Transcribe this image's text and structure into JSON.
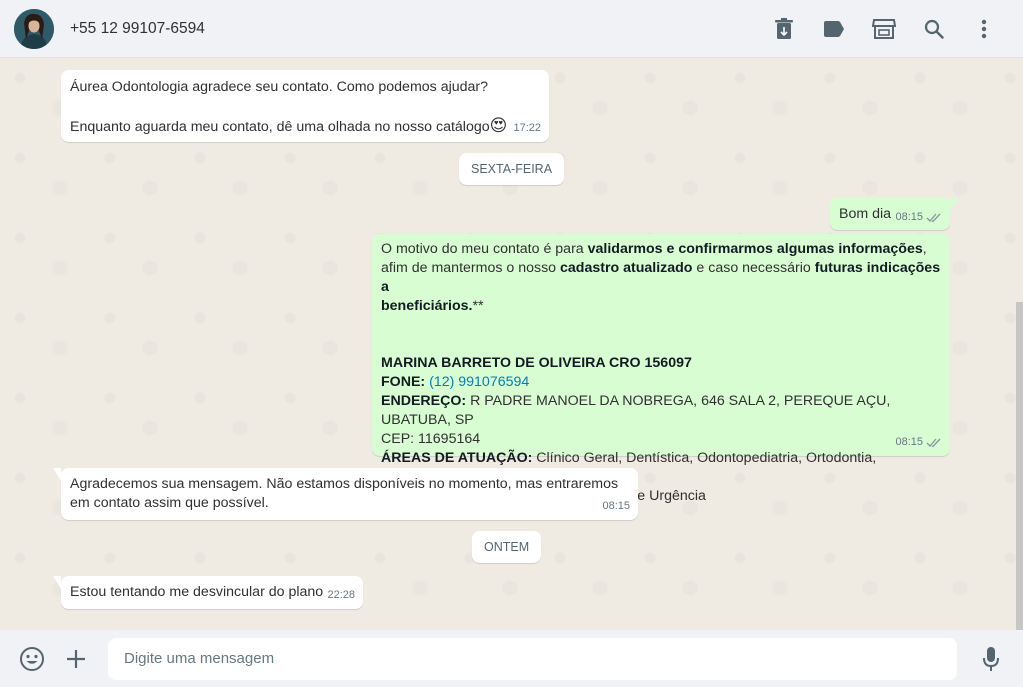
{
  "header": {
    "contact_name": "+55 12 99107-6594",
    "actions": [
      "archive-delete-icon",
      "label-icon",
      "catalog-store-icon",
      "search-icon",
      "menu-icon"
    ]
  },
  "messages": {
    "m1": {
      "line1": "Áurea Odontologia  agradece seu contato. Como podemos ajudar?",
      "line2": "Enquanto aguarda meu contato, dê uma olhada no nosso catálogo",
      "emoji": "😍",
      "time": "17:22"
    },
    "date1": "SEXTA-FEIRA",
    "m2": {
      "text": "Bom dia",
      "time": "08:15"
    },
    "m3": {
      "p1_a": "O motivo do meu contato é para ",
      "p1_b": "validarmos e confirmarmos algumas informações",
      "p1_c": ",",
      "p2_a": "afim de mantermos o nosso ",
      "p2_b": "cadastro atualizado",
      "p2_c": " e caso necessário ",
      "p2_d": "futuras indicações a",
      "p3_a": "beneficiários.",
      "p3_b": "**",
      "name": "MARINA BARRETO DE OLIVEIRA CRO 156097",
      "phone_label": "FONE:",
      "phone": "(12) 991076594",
      "address_label": "ENDEREÇO:",
      "address": " R PADRE MANOEL DA NOBREGA, 646 SALA 2, PEREQUE AÇU, UBATUBA, SP",
      "cep": "CEP: 11695164",
      "areas_label": "ÁREAS DE ATUAÇÃO:",
      "areas_1": " Clínico Geral, Dentística, Odontopediatria, Ortodontia, Ortopedia",
      "areas_2": "Funcional dos Maxilares - Atendimento de Urgência",
      "time": "08:15"
    },
    "m4": {
      "line1": "Agradecemos sua mensagem. Não estamos disponíveis no momento, mas entraremos",
      "line2": "em contato assim que possível.",
      "time": "08:15"
    },
    "date2": "ONTEM",
    "m5": {
      "text": "Estou tentando me desvincular do plano",
      "time": "22:28"
    }
  },
  "composer": {
    "placeholder": "Digite uma mensagem"
  },
  "colors": {
    "incoming": "#ffffff",
    "outgoing": "#d9fdd3",
    "background": "#efeae2",
    "link": "#027eb5"
  }
}
